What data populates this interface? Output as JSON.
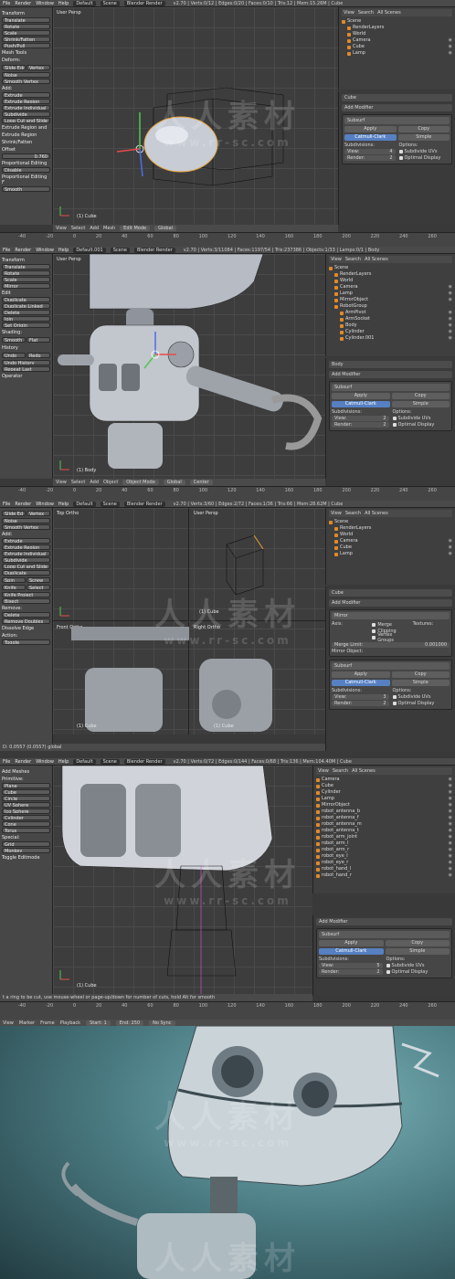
{
  "menus": [
    "File",
    "Render",
    "Window",
    "Help"
  ],
  "panels": [
    {
      "layout": "Default",
      "scene": "Scene",
      "engine": "Blender Render",
      "stats": "v2.70 | Verts:0/12 | Edges:0/20 | Faces:0/10 | Tris:12 | Mem:15.26M | Cube",
      "viewport_label": "User Persp",
      "object_label": "(1) Cube",
      "tools": [
        {
          "section": "Transform",
          "buttons": [
            "Translate",
            "Rotate",
            "Scale",
            "Shrink/Fatten",
            "Push/Pull"
          ]
        },
        {
          "section": "Mesh Tools",
          "buttons": [
            "Deform:",
            "Slide Edge",
            "Vertex",
            "Noise",
            "Smooth Vertex",
            "Add:",
            "Extrude",
            "Extrude Region",
            "Extrude Individual",
            "Subdivide",
            "Loop Cut and Slide"
          ]
        },
        {
          "section": "Extrude Region and",
          "buttons": [
            "Extrude Region",
            "Shrink/Fatten",
            "Offset",
            "0.760"
          ]
        },
        {
          "section": "Proportional Editing",
          "buttons": [
            "Disable",
            "Proportional Editing F",
            "Smooth"
          ]
        }
      ],
      "outliner_header": [
        "View",
        "Search",
        "All Scenes"
      ],
      "outliner": [
        "Scene",
        "RenderLayers",
        "World",
        "Camera",
        "Cube",
        "Lamp"
      ],
      "props_title": "Cube",
      "add_modifier": "Add Modifier",
      "modifier_name": "Subsurf",
      "apply": "Apply",
      "copy": "Copy",
      "cc": "Catmull-Clark",
      "simple": "Simple",
      "subdivisions": "Subdivisions:",
      "view": "View:",
      "view_val": "4",
      "render": "Render:",
      "render_val": "2",
      "options": "Options:",
      "opt1": "Subdivide UVs",
      "opt2": "Optimal Display",
      "viewbar": [
        "View",
        "Select",
        "Add",
        "Mesh",
        "Edit Mode",
        "Global"
      ],
      "timeline": [
        "View",
        "Marker",
        "Frame",
        "Playback",
        "Start:",
        "1",
        "End:",
        "250",
        "No Sync"
      ],
      "ticks": [
        "-40",
        "-20",
        "0",
        "20",
        "40",
        "60",
        "80",
        "100",
        "120",
        "140",
        "160",
        "180",
        "200",
        "220",
        "240",
        "260"
      ]
    },
    {
      "layout": "Default.001",
      "scene": "Scene",
      "engine": "Blender Render",
      "stats": "v2.70 | Verts:3/11084 | Faces:1197/54 | Tris:237386 | Objects:1/33 | Lamps:0/1 | Body",
      "viewport_label": "User Persp",
      "object_label": "(1) Body",
      "tools": [
        {
          "section": "Transform",
          "buttons": [
            "Translate",
            "Rotate",
            "Scale",
            "Mirror"
          ]
        },
        {
          "section": "Edit",
          "buttons": [
            "Duplicate",
            "Duplicate Linked",
            "Delete",
            "Join",
            "Set Origin",
            "Shading:",
            "Smooth",
            "Flat"
          ]
        },
        {
          "section": "History",
          "buttons": [
            "Undo",
            "Redo",
            "Undo History",
            "Repeat Last"
          ]
        },
        {
          "section": "Operator",
          "buttons": []
        }
      ],
      "outliner_header": [
        "View",
        "Search",
        "All Scenes"
      ],
      "outliner": [
        "Scene",
        "RenderLayers",
        "World",
        "Camera",
        "Lamp",
        "MirrorObject",
        "RobotGroup",
        "ArmPivot",
        "ArmSocket",
        "Body",
        "Cylinder",
        "Cylinder.001"
      ],
      "props_title": "Body",
      "add_modifier": "Add Modifier",
      "modifier_name": "Subsurf",
      "apply": "Apply",
      "copy": "Copy",
      "cc": "Catmull-Clark",
      "simple": "Simple",
      "subdivisions": "Subdivisions:",
      "view": "View:",
      "view_val": "2",
      "render": "Render:",
      "render_val": "2",
      "options": "Options:",
      "opt1": "Subdivide UVs",
      "opt2": "Optimal Display",
      "viewbar": [
        "View",
        "Select",
        "Add",
        "Object",
        "Object Mode",
        "Global",
        "Center"
      ],
      "timeline": [
        "View",
        "Marker",
        "Frame",
        "Playback",
        "Start:",
        "1",
        "End:",
        "250",
        "No Sync"
      ],
      "ticks": [
        "-40",
        "-20",
        "0",
        "20",
        "40",
        "60",
        "80",
        "100",
        "120",
        "140",
        "160",
        "180",
        "200",
        "220",
        "240",
        "260"
      ]
    },
    {
      "layout": "Default",
      "scene": "Scene",
      "engine": "Blender Render",
      "stats": "v2.70 | Verts:3/60 | Edges:2/72 | Faces:1/36 | Tris:66 | Mem:28.62M | Cube",
      "viewport_label": "Top Ortho",
      "viewport_label2": "User Persp",
      "viewport_label3": "Front Ortho",
      "viewport_label4": "Right Ortho",
      "object_label": "(1) Cube",
      "tools": [
        {
          "section": "",
          "buttons": [
            "Slide Ed",
            "Vertex",
            "Noise",
            "Smooth Vertex",
            "Add:",
            "Extrude",
            "Extrude Region",
            "Extrude Individual",
            "Subdivide",
            "Loop Cut and Slide",
            "Duplicate",
            "Spin",
            "Screw",
            "Knife",
            "Select",
            "Knife Project",
            "Bisect",
            "Remove:",
            "Delete",
            "Remove Doubles"
          ]
        },
        {
          "section": "Dissolve Edge",
          "buttons": [
            "Action:",
            "Toggle"
          ]
        }
      ],
      "outliner_header": [
        "View",
        "Search",
        "All Scenes"
      ],
      "outliner": [
        "Scene",
        "RenderLayers",
        "World",
        "Camera",
        "Cube",
        "Lamp"
      ],
      "props_title": "Cube",
      "add_modifier": "Add Modifier",
      "mirror": "Mirror",
      "axis": "Axis:",
      "mirror_opts": [
        "Merge",
        "Clipping",
        "Vertex Groups"
      ],
      "textures": "Textures:",
      "merge_limit": "Merge Limit:",
      "merge_val": "0.001000",
      "mirror_object": "Mirror Object:",
      "modifier_name": "Subsurf",
      "apply": "Apply",
      "copy": "Copy",
      "cc": "Catmull-Clark",
      "simple": "Simple",
      "subdivisions": "Subdivisions:",
      "view": "View:",
      "view_val": "3",
      "render": "Render:",
      "render_val": "2",
      "options": "Options:",
      "opt1": "Subdivide UVs",
      "opt2": "Optimal Display",
      "status": "D: 0.0557 (0.0557) global"
    },
    {
      "layout": "Default",
      "scene": "Scene",
      "engine": "Blender Render",
      "stats": "v2.70 | Verts:0/72 | Edges:0/144 | Faces:0/68 | Tris:136 | Mem:104.40M | Cube",
      "object_label": "(1) Cube",
      "tools": [
        {
          "section": "Add Meshes",
          "buttons": [
            "Primitive:",
            "Plane",
            "Cube",
            "Circle",
            "UV Sphere",
            "Ico Sphere",
            "Cylinder",
            "Cone",
            "Torus",
            "Special:",
            "Grid",
            "Monkey"
          ]
        },
        {
          "section": "Toggle Editmode",
          "buttons": []
        }
      ],
      "outliner_header": [
        "View",
        "Search",
        "All Scenes"
      ],
      "outliner": [
        "Camera",
        "Cube",
        "Cylinder",
        "Lamp",
        "MirrorObject",
        "robot_antenna_b",
        "robot_antenna_f",
        "robot_antenna_m",
        "robot_antenna_t",
        "robot_arm_joint",
        "robot_arm_l",
        "robot_arm_r",
        "robot_eye_l",
        "robot_eye_r",
        "robot_hand_l",
        "robot_hand_r"
      ],
      "add_modifier": "Add Modifier",
      "modifier_name": "Subsurf",
      "apply": "Apply",
      "copy": "Copy",
      "cc": "Catmull-Clark",
      "simple": "Simple",
      "subdivisions": "Subdivisions:",
      "view": "View:",
      "view_val": "5",
      "render": "Render:",
      "render_val": "2",
      "options": "Options:",
      "opt1": "Subdivide UVs",
      "opt2": "Optimal Display",
      "status": "t a ring to be cut, use mouse-wheel or page-up/down for number of cuts, hold Alt for smooth",
      "timeline": [
        "View",
        "Marker",
        "Frame",
        "Playback",
        "Start:",
        "1",
        "End:",
        "250",
        "No Sync"
      ],
      "ticks": [
        "-40",
        "-20",
        "0",
        "20",
        "40",
        "60",
        "80",
        "100",
        "120",
        "140",
        "160",
        "180",
        "200",
        "220",
        "240",
        "260"
      ]
    }
  ],
  "watermark": {
    "text": "人人素材",
    "url": "www.rr-sc.com"
  },
  "colors": {
    "accent": "#5680c2",
    "object_orange": "#e08a2a",
    "bg": "#393939"
  }
}
